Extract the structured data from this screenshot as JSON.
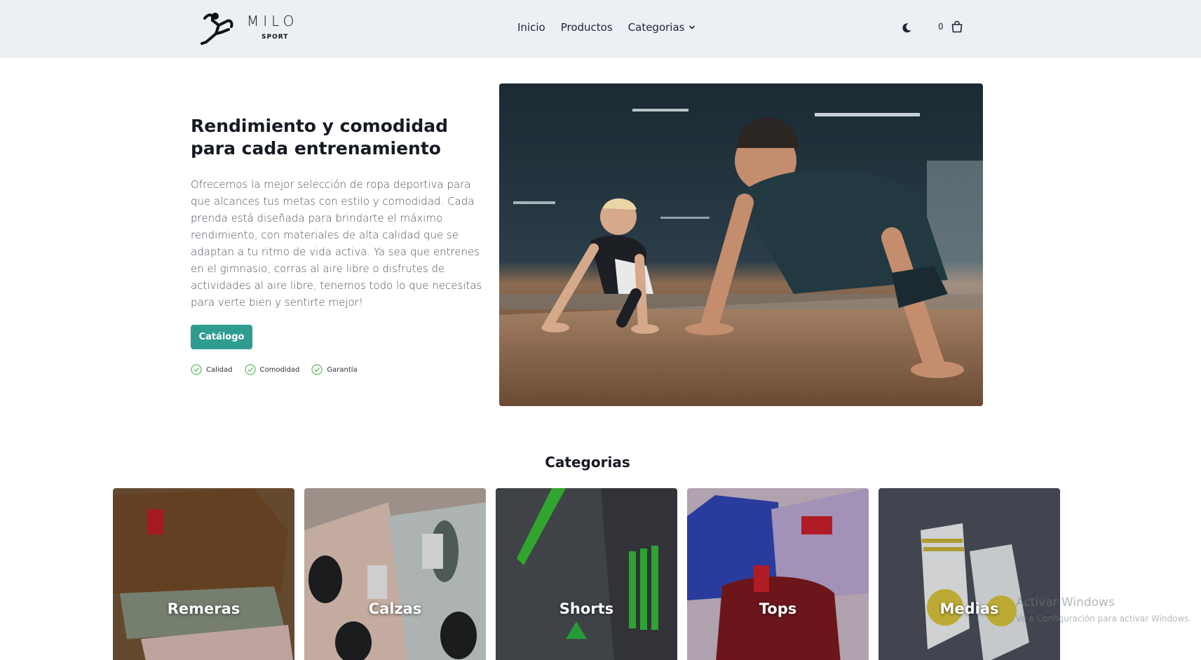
{
  "brand": {
    "logo_word": "MILO",
    "logo_sub": "SPORT"
  },
  "nav": {
    "links": [
      "Inicio",
      "Productos"
    ],
    "dropdown_label": "Categorias",
    "cart_count": "0"
  },
  "hero": {
    "title": "Rendimiento y comodidad para cada entrenamiento",
    "description": "Ofrecemos la mejor selección de ropa deportiva para que alcances tus metas con estilo y comodidad. Cada prenda está diseñada para brindarte el máximo rendimiento, con materiales de alta calidad que se adaptan a tu ritmo de vida activa. Ya sea que entrenes en el gimnasio, corras al aire libre o disfrutes de actividades al aire libre, tenemos todo lo que necesitas para verte bien y sentirte mejor!",
    "cta_label": "Catálogo",
    "features": [
      "Calidad",
      "Comodidad",
      "Garantía"
    ]
  },
  "categories": {
    "title": "Categorias",
    "items": [
      "Remeras",
      "Calzas",
      "Shorts",
      "Tops",
      "Medias"
    ]
  },
  "watermark": {
    "title": "Activar Windows",
    "subtitle": "Ve a Configuración para activar Windows."
  },
  "colors": {
    "nav_bg": "#ecf0f4",
    "accent": "#2f9c92",
    "check": "#5cb85c"
  }
}
